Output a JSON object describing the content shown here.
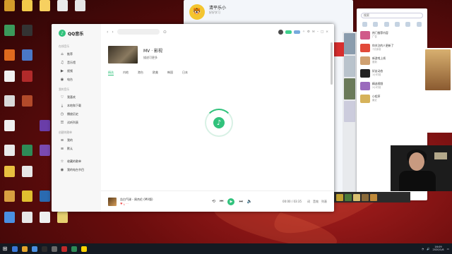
{
  "desktop": {
    "icons": [
      {
        "label": "",
        "color": "#d49b2a"
      },
      {
        "label": "",
        "color": "#f1c94a"
      },
      {
        "label": "",
        "color": "#f7d060"
      },
      {
        "label": "",
        "color": "#e9e9e9"
      },
      {
        "label": "",
        "color": "#e6e6e6"
      },
      {
        "label": "",
        "color": "#3b9a5b"
      },
      {
        "label": "",
        "color": "#333333"
      },
      {
        "label": "",
        "color": "#e06a1e"
      },
      {
        "label": "",
        "color": "#4a78c8"
      },
      {
        "label": "",
        "color": "#f0f0f0"
      },
      {
        "label": "",
        "color": "#b12a2a"
      },
      {
        "label": "",
        "color": "#d9d9d9"
      },
      {
        "label": "",
        "color": "#b24a2a"
      },
      {
        "label": "",
        "color": "#f0f0f0"
      },
      {
        "label": "",
        "color": "#6a3da8"
      }
    ]
  },
  "music_app": {
    "app_name": "QQ音乐",
    "sidebar_sections": [
      {
        "title": "在线音乐",
        "items": [
          {
            "label": "推荐",
            "icon": "home-icon"
          },
          {
            "label": "音乐馆",
            "icon": "music-icon"
          },
          {
            "label": "视频",
            "icon": "video-icon"
          },
          {
            "label": "电台",
            "icon": "radio-icon"
          }
        ]
      },
      {
        "title": "我的音乐",
        "items": [
          {
            "label": "我喜欢",
            "icon": "heart-icon"
          },
          {
            "label": "本地和下载",
            "icon": "download-icon"
          },
          {
            "label": "播放历史",
            "icon": "history-icon"
          },
          {
            "label": "试听列表",
            "icon": "list-icon"
          }
        ]
      },
      {
        "title": "创建的歌单",
        "items": [
          {
            "label": "我的",
            "icon": "playlist-icon"
          },
          {
            "label": "默认",
            "icon": "playlist-icon"
          }
        ]
      },
      {
        "title": "",
        "items": [
          {
            "label": "收藏的歌单",
            "icon": "star-icon"
          },
          {
            "label": "我的电台节目",
            "icon": "radio-icon"
          }
        ]
      }
    ],
    "search_value": "",
    "header": {
      "title": "MV · 影视",
      "subtitle": "描述可更多"
    },
    "tabs": [
      "精选",
      "内地",
      "港台",
      "欧美",
      "韩国",
      "日本"
    ],
    "player": {
      "track": "告白气球 - 周杰伦 (MV版)",
      "time": "00:00 / 03:35",
      "right_labels": [
        "词",
        "音效",
        "列表"
      ]
    }
  },
  "qq_panel": {
    "name": "清平乐小",
    "signature": "好好学习"
  },
  "search_panel": {
    "placeholder": "搜索",
    "feed": [
      {
        "title": "热门推荐内容",
        "sub": "广告",
        "color": "#d05a8a"
      },
      {
        "title": "你关注的人更新了",
        "sub": "7分钟前",
        "color": "#e24a3a"
      },
      {
        "title": "新游戏上线",
        "sub": "更新",
        "color": "#cfa070"
      },
      {
        "title": "好友动态",
        "sub": "1小时前",
        "color": "#222222"
      },
      {
        "title": "精选视频",
        "sub": "2小时前",
        "color": "#9a6abd"
      },
      {
        "title": "小程序",
        "sub": "最近",
        "color": "#d6b25a"
      }
    ]
  },
  "taskbar": {
    "time": "16:09",
    "date": "2020/1/6",
    "apps": [
      "#3a78d8",
      "#e4a52c",
      "#4a90e2",
      "#2b2b2b",
      "#6a6a6a",
      "#c02a2a",
      "#2e8b57",
      "#ffd400"
    ]
  }
}
